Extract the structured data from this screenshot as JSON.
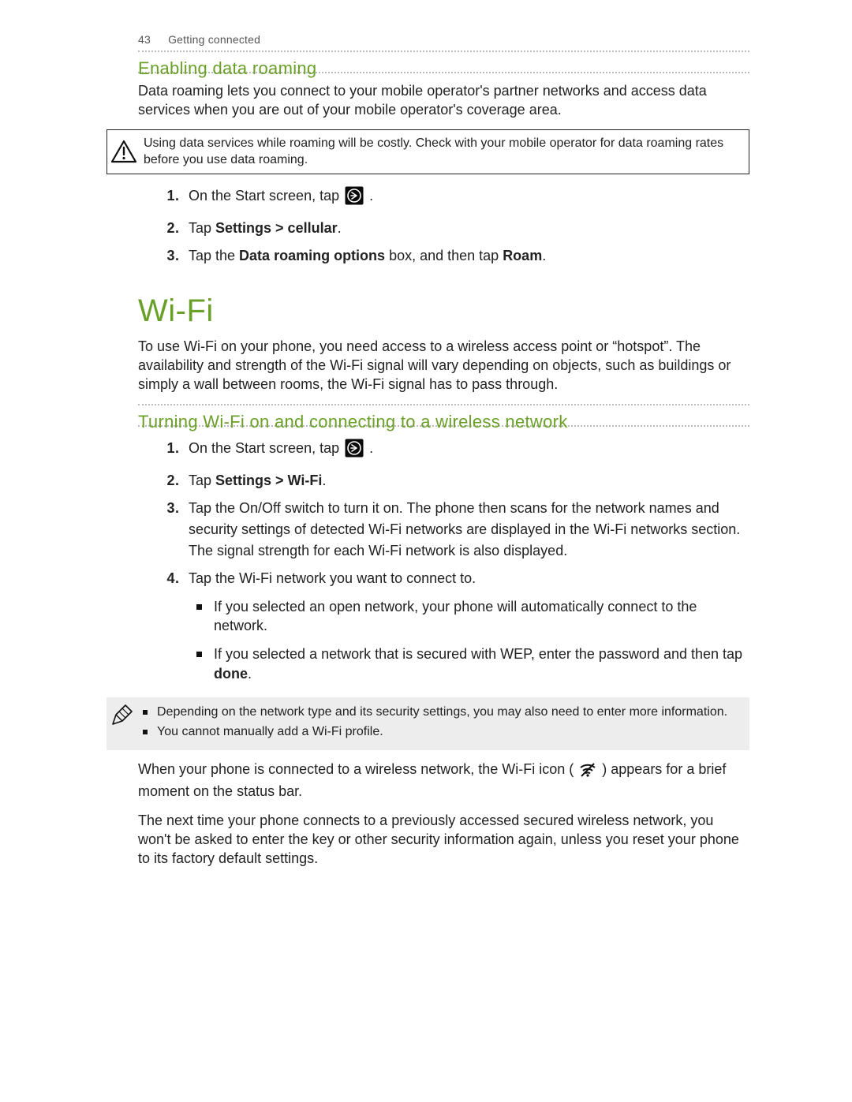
{
  "header": {
    "page_number": "43",
    "section": "Getting connected"
  },
  "roaming": {
    "subheading": "Enabling data roaming",
    "intro": "Data roaming lets you connect to your mobile operator's partner networks and access data services when you are out of your mobile operator's coverage area.",
    "warning": "Using data services while roaming will be costly. Check with your mobile operator for data roaming rates before you use data roaming.",
    "steps": {
      "s1_a": "On the Start screen, tap ",
      "s1_b": ".",
      "s2_a": "Tap ",
      "s2_bold": "Settings > cellular",
      "s2_b": ".",
      "s3_a": "Tap the ",
      "s3_bold1": "Data roaming options",
      "s3_b": " box, and then tap ",
      "s3_bold2": "Roam",
      "s3_c": "."
    }
  },
  "wifi": {
    "heading": "Wi-Fi",
    "intro": "To use Wi-Fi on your phone, you need access to a wireless access point or “hotspot”. The availability and strength of the Wi-Fi signal will vary depending on objects, such as buildings or simply a wall between rooms, the Wi-Fi signal has to pass through.",
    "subheading": "Turning Wi-Fi on and connecting to a wireless network",
    "steps": {
      "s1_a": "On the Start screen, tap ",
      "s1_b": ".",
      "s2_a": "Tap ",
      "s2_bold": "Settings > Wi-Fi",
      "s2_b": ".",
      "s3": "Tap the On/Off switch to turn it on. The phone then scans for the network names and security settings of detected Wi-Fi networks are displayed in the Wi-Fi networks section. The signal strength for each Wi-Fi network is also displayed.",
      "s4": "Tap the Wi-Fi network you want to connect to.",
      "s4_sub1": "If you selected an open network, your phone will automatically connect to the network.",
      "s4_sub2_a": "If you selected a network that is secured with WEP, enter the password and then tap ",
      "s4_sub2_bold": "done",
      "s4_sub2_b": "."
    },
    "notes": {
      "n1": "Depending on the network type and its security settings, you may also need to enter more information.",
      "n2": "You cannot manually add a Wi-Fi profile."
    },
    "after1_a": "When your phone is connected to a wireless network, the Wi-Fi icon ( ",
    "after1_b": " ) appears for a brief moment on the status bar.",
    "after2": "The next time your phone connects to a previously accessed secured wireless network, you won't be asked to enter the key or other security information again, unless you reset your phone to its factory default settings."
  }
}
